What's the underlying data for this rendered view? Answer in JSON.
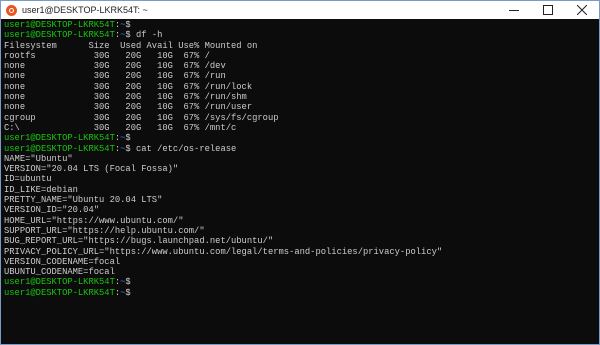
{
  "window": {
    "title": "user1@DESKTOP-LKRK54T: ~",
    "icon": "ubuntu-icon",
    "controls": [
      "minimize",
      "maximize",
      "close"
    ]
  },
  "terminal": {
    "prompt_user": "user1@DESKTOP-LKRK54T",
    "prompt_path": "~",
    "lines": [
      {
        "type": "prompt",
        "user": "user1@DESKTOP-LKRK54T",
        "path": "~",
        "cmd": ""
      },
      {
        "type": "prompt",
        "user": "user1@DESKTOP-LKRK54T",
        "path": "~",
        "cmd": "df -h"
      },
      {
        "type": "out",
        "text": "Filesystem      Size  Used Avail Use% Mounted on"
      },
      {
        "type": "out",
        "text": "rootfs           30G   20G   10G  67% /"
      },
      {
        "type": "out",
        "text": "none             30G   20G   10G  67% /dev"
      },
      {
        "type": "out",
        "text": "none             30G   20G   10G  67% /run"
      },
      {
        "type": "out",
        "text": "none             30G   20G   10G  67% /run/lock"
      },
      {
        "type": "out",
        "text": "none             30G   20G   10G  67% /run/shm"
      },
      {
        "type": "out",
        "text": "none             30G   20G   10G  67% /run/user"
      },
      {
        "type": "out",
        "text": "cgroup           30G   20G   10G  67% /sys/fs/cgroup"
      },
      {
        "type": "out",
        "text": "C:\\              30G   20G   10G  67% /mnt/c"
      },
      {
        "type": "prompt",
        "user": "user1@DESKTOP-LKRK54T",
        "path": "~",
        "cmd": ""
      },
      {
        "type": "prompt",
        "user": "user1@DESKTOP-LKRK54T",
        "path": "~",
        "cmd": "cat /etc/os-release"
      },
      {
        "type": "out",
        "text": "NAME=\"Ubuntu\""
      },
      {
        "type": "out",
        "text": "VERSION=\"20.04 LTS (Focal Fossa)\""
      },
      {
        "type": "out",
        "text": "ID=ubuntu"
      },
      {
        "type": "out",
        "text": "ID_LIKE=debian"
      },
      {
        "type": "out",
        "text": "PRETTY_NAME=\"Ubuntu 20.04 LTS\""
      },
      {
        "type": "out",
        "text": "VERSION_ID=\"20.04\""
      },
      {
        "type": "out",
        "text": "HOME_URL=\"https://www.ubuntu.com/\""
      },
      {
        "type": "out",
        "text": "SUPPORT_URL=\"https://help.ubuntu.com/\""
      },
      {
        "type": "out",
        "text": "BUG_REPORT_URL=\"https://bugs.launchpad.net/ubuntu/\""
      },
      {
        "type": "out",
        "text": "PRIVACY_POLICY_URL=\"https://www.ubuntu.com/legal/terms-and-policies/privacy-policy\""
      },
      {
        "type": "out",
        "text": "VERSION_CODENAME=focal"
      },
      {
        "type": "out",
        "text": "UBUNTU_CODENAME=focal"
      },
      {
        "type": "prompt",
        "user": "user1@DESKTOP-LKRK54T",
        "path": "~",
        "cmd": ""
      },
      {
        "type": "prompt",
        "user": "user1@DESKTOP-LKRK54T",
        "path": "~",
        "cmd": "",
        "cursor": true
      }
    ]
  },
  "colors": {
    "background": "#0c0c0c",
    "text": "#cccccc",
    "prompt_user": "#16c60c",
    "prompt_path": "#3b78ff",
    "ubuntu_orange": "#e95420"
  }
}
